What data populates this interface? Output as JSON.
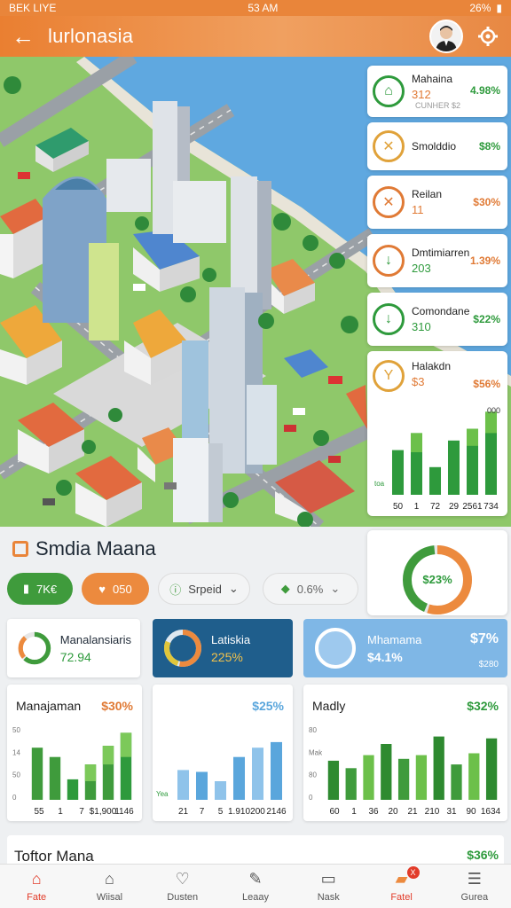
{
  "status": {
    "left": "BEK LIYE",
    "time": "53 AM",
    "battery": "26%"
  },
  "header": {
    "title": "lurlonasia"
  },
  "colors": {
    "orange": "#e9853a",
    "green": "#2e9a3c",
    "lightgreen": "#6cc04a",
    "blue": "#1f5e8c",
    "skyblue": "#7fb7e6"
  },
  "stats": [
    {
      "name": "Mahaina",
      "value": "312",
      "sub": "CUNHER $2",
      "pct": "4.98%",
      "icon": "house-icon",
      "color": "#2e9a3c",
      "pctColor": "#2e9a3c"
    },
    {
      "name": "Smolddio",
      "value": "",
      "sub": "",
      "pct": "$8%",
      "icon": "close-icon",
      "color": "#e0a23a",
      "pctColor": "#2e9a3c"
    },
    {
      "name": "Reilan",
      "value": "11",
      "sub": "",
      "pct": "$30%",
      "icon": "close-icon",
      "color": "#e07a35",
      "pctColor": "#e07a35"
    },
    {
      "name": "Dmtimiarren",
      "value": "203",
      "sub": "",
      "pct": "1.39%",
      "icon": "down-arrow-icon",
      "color": "#e07a35",
      "pctColor": "#e07a35"
    },
    {
      "name": "Comondane",
      "value": "310",
      "sub": "",
      "pct": "$22%",
      "icon": "down-arrow-icon",
      "color": "#2e9a3c",
      "pctColor": "#2e9a3c"
    },
    {
      "name": "Halakdn",
      "value": "$3",
      "sub": "",
      "pct": "$56%",
      "icon": "y-icon",
      "color": "#e0a23a",
      "pctColor": "#e07a35"
    }
  ],
  "mini_chart": {
    "top_label": "000",
    "left_label": "toa",
    "x_labels": [
      "50",
      "1",
      "72",
      "29",
      "2561",
      "734"
    ],
    "values": [
      42,
      58,
      26,
      51,
      62,
      78
    ],
    "overlay": [
      0,
      18,
      0,
      0,
      16,
      20
    ]
  },
  "section": {
    "title": "Smdia Maana"
  },
  "pills": [
    {
      "label": "7K€",
      "icon": "chart-icon"
    },
    {
      "label": "050",
      "icon": "heart-icon"
    },
    {
      "label": "Srpeid",
      "icon": "info-icon"
    },
    {
      "label": "0.6%",
      "icon": "tag-icon"
    }
  ],
  "donut_main": {
    "label": "$23%",
    "segments": [
      55,
      30,
      15
    ]
  },
  "kpis": [
    {
      "label": "Manalansiaris",
      "value": "72.94"
    },
    {
      "label": "Latiskia",
      "value": "225%"
    },
    {
      "label": "Mhamama",
      "value": "$4.1%",
      "pct": "$7%",
      "sub": "$280"
    }
  ],
  "charts": [
    {
      "title": "Manajaman",
      "pct": "$30%",
      "y_ticks": [
        "50",
        "14",
        "50",
        "0"
      ],
      "x_labels": [
        "55",
        "1",
        "7",
        "$1,900",
        "1146"
      ],
      "values": [
        56,
        46,
        22,
        38,
        58,
        72
      ],
      "overlay": [
        0,
        0,
        0,
        18,
        20,
        26
      ]
    },
    {
      "title": "",
      "pct": "$25%",
      "y_ticks": [],
      "y_label": "Yea",
      "x_labels": [
        "21",
        "7",
        "5",
        "1.910",
        "200",
        "2146"
      ],
      "values": [
        32,
        30,
        20,
        46,
        56,
        62
      ],
      "overlay": [
        0,
        0,
        0,
        0,
        0,
        0
      ]
    },
    {
      "title": "Madly",
      "pct": "$32%",
      "y_ticks": [
        "80",
        "Mak",
        "80",
        "0"
      ],
      "x_labels": [
        "60",
        "1",
        "36",
        "20",
        "21",
        "210",
        "31",
        "90",
        "1634"
      ],
      "values": [
        42,
        34,
        48,
        60,
        44,
        48,
        68,
        38,
        50,
        66
      ],
      "overlay": [
        0,
        0,
        0,
        0,
        0,
        0,
        0,
        0,
        0,
        0
      ]
    }
  ],
  "bottom": {
    "title": "Toftor Mana",
    "pct": "$36%"
  },
  "tabs": [
    {
      "label": "Fate",
      "icon": "home-icon",
      "active": true
    },
    {
      "label": "Wiisal",
      "icon": "house-outline-icon"
    },
    {
      "label": "Dusten",
      "icon": "heart-icon"
    },
    {
      "label": "Leaay",
      "icon": "edit-icon"
    },
    {
      "label": "Nask",
      "icon": "monitor-icon"
    },
    {
      "label": "Fatel",
      "icon": "briefcase-icon",
      "badge": "X"
    },
    {
      "label": "Gurea",
      "icon": "list-icon"
    }
  ]
}
